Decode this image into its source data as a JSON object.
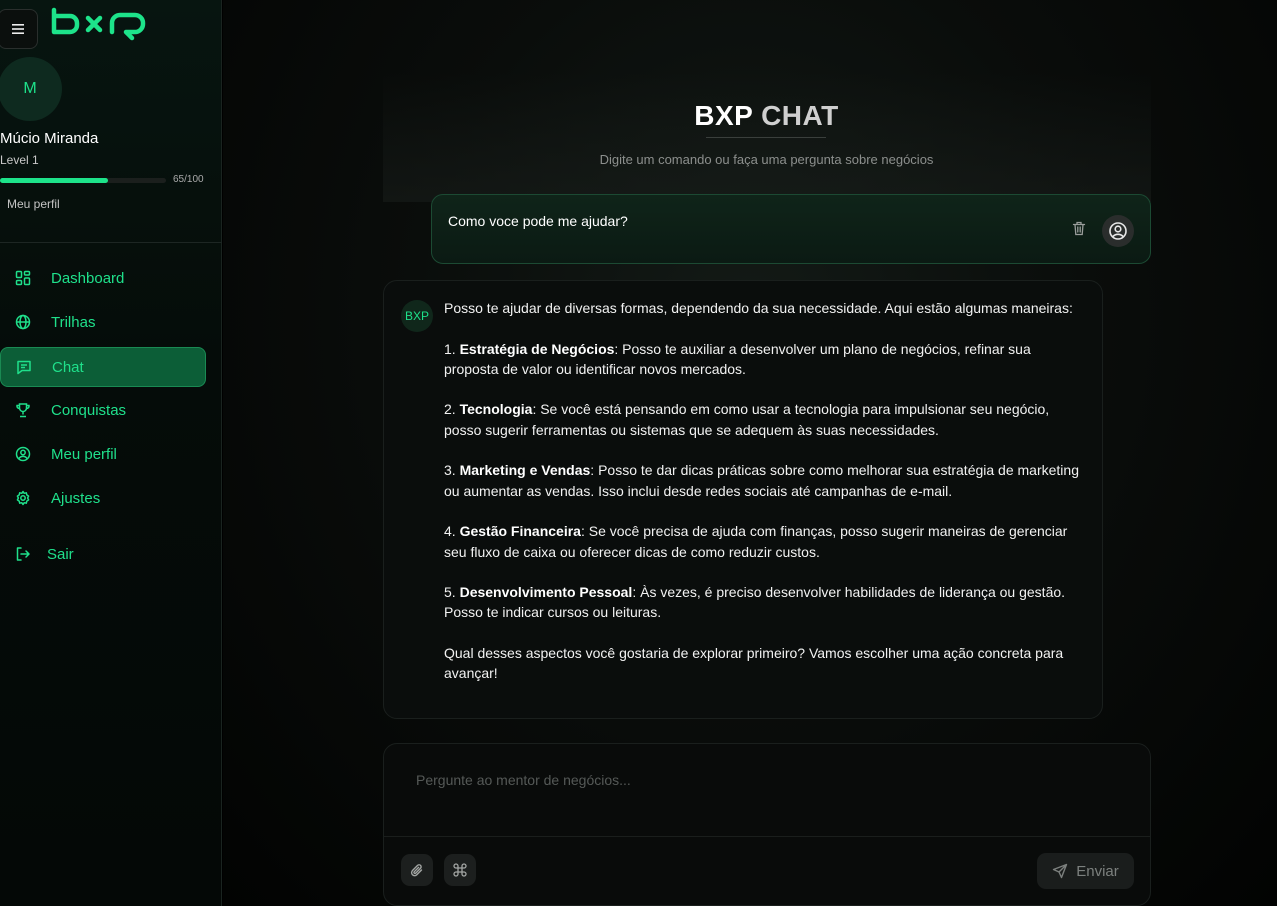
{
  "brand": {
    "logo_text": "bxp",
    "accent": "#1de38a"
  },
  "user": {
    "avatar_initial": "M",
    "name": "Múcio Miranda",
    "level": "Level 1",
    "xp_text": "65/100",
    "xp_progress": 0.65,
    "profile_link": "Meu perfil"
  },
  "nav": {
    "items": [
      {
        "label": "Dashboard",
        "icon": "dashboard-icon"
      },
      {
        "label": "Trilhas",
        "icon": "globe-icon"
      },
      {
        "label": "Chat",
        "icon": "chat-icon",
        "active": true
      },
      {
        "label": "Conquistas",
        "icon": "trophy-icon"
      },
      {
        "label": "Meu perfil",
        "icon": "user-circle-icon"
      },
      {
        "label": "Ajustes",
        "icon": "gear-icon"
      }
    ],
    "logout": {
      "label": "Sair",
      "icon": "logout-icon"
    }
  },
  "header": {
    "title_part1": "BXP",
    "title_part2": "CHAT",
    "subtitle": "Digite um comando ou faça uma pergunta sobre negócios"
  },
  "messages": {
    "user": {
      "text": "Como voce pode me ajudar?"
    },
    "bot": {
      "avatar_label": "BXP",
      "intro": "Posso te ajudar de diversas formas, dependendo da sua necessidade. Aqui estão algumas maneiras:",
      "points": [
        {
          "num": "1.",
          "title": "Estratégia de Negócios",
          "text": ": Posso te auxiliar a desenvolver um plano de negócios, refinar sua proposta de valor ou identificar novos mercados."
        },
        {
          "num": "2.",
          "title": "Tecnologia",
          "text": ": Se você está pensando em como usar a tecnologia para impulsionar seu negócio, posso sugerir ferramentas ou sistemas que se adequem às suas necessidades."
        },
        {
          "num": "3.",
          "title": "Marketing e Vendas",
          "text": ": Posso te dar dicas práticas sobre como melhorar sua estratégia de marketing ou aumentar as vendas. Isso inclui desde redes sociais até campanhas de e-mail."
        },
        {
          "num": "4.",
          "title": "Gestão Financeira",
          "text": ": Se você precisa de ajuda com finanças, posso sugerir maneiras de gerenciar seu fluxo de caixa ou oferecer dicas de como reduzir custos."
        },
        {
          "num": "5.",
          "title": "Desenvolvimento Pessoal",
          "text": ": Às vezes, é preciso desenvolver habilidades de liderança ou gestão. Posso te indicar cursos ou leituras."
        }
      ],
      "closing": "Qual desses aspectos você gostaria de explorar primeiro? Vamos escolher uma ação concreta para avançar!"
    }
  },
  "composer": {
    "placeholder": "Pergunte ao mentor de negócios...",
    "send_label": "Enviar"
  }
}
